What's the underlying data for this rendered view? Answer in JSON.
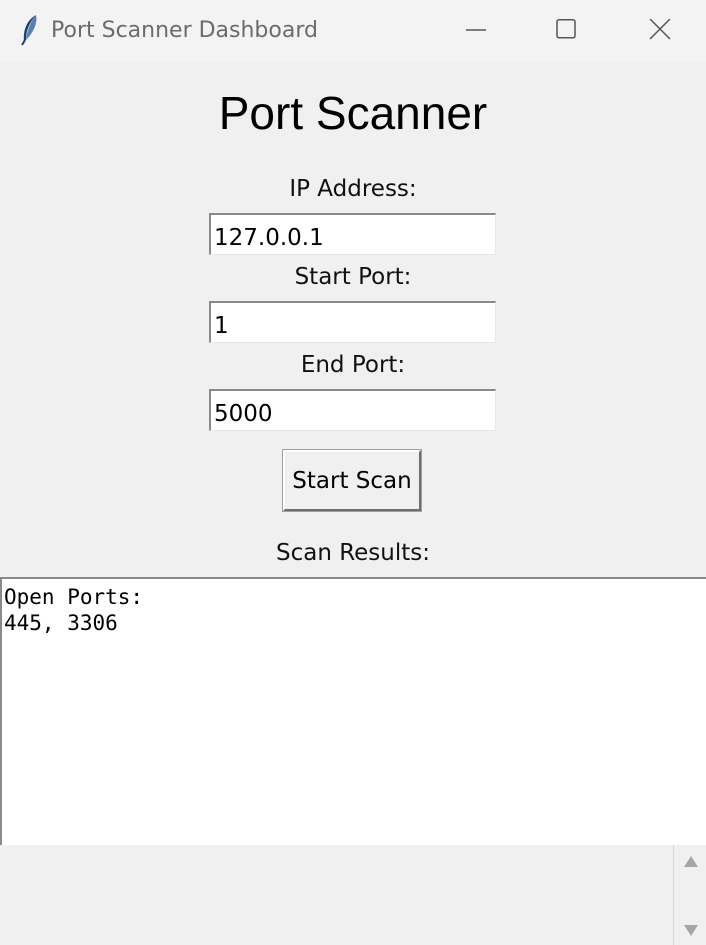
{
  "window": {
    "title": "Port Scanner Dashboard",
    "icon": "feather-icon",
    "controls": [
      "minimize-icon",
      "maximize-icon",
      "close-icon"
    ]
  },
  "main": {
    "heading": "Port Scanner",
    "ip": {
      "label": "IP Address:",
      "value": "127.0.0.1"
    },
    "start_port": {
      "label": "Start Port:",
      "value": "1"
    },
    "end_port": {
      "label": "End Port:",
      "value": "5000"
    },
    "scan_button": "Start Scan",
    "results_label": "Scan Results:",
    "results_text": "Open Ports:\n445, 3306"
  },
  "scrollbar": {
    "icons": [
      "scroll-up-arrow-icon",
      "scroll-down-arrow-icon"
    ]
  },
  "colors": {
    "background": "#f0f0f0",
    "field_background": "#ffffff"
  }
}
